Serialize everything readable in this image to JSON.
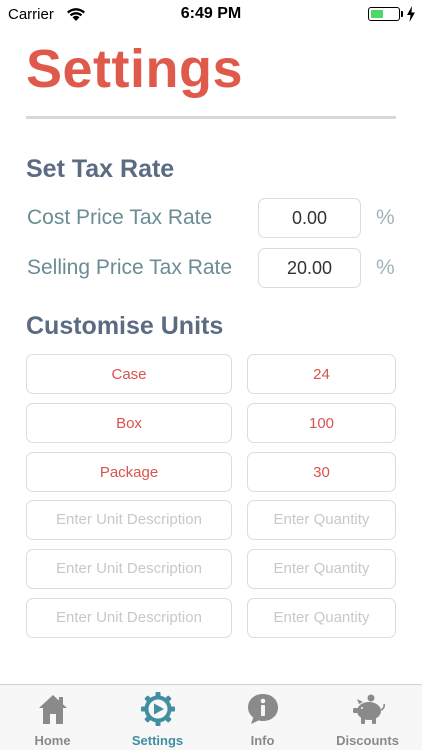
{
  "status_bar": {
    "carrier": "Carrier",
    "time": "6:49 PM",
    "battery_level": 0.45,
    "battery_color": "#4cd964"
  },
  "title": "Settings",
  "tax_section": {
    "heading": "Set Tax Rate",
    "rows": [
      {
        "label": "Cost Price Tax Rate",
        "value": "0.00",
        "unit": "%"
      },
      {
        "label": "Selling Price Tax Rate",
        "value": "20.00",
        "unit": "%"
      }
    ]
  },
  "units_section": {
    "heading": "Customise Units",
    "desc_placeholder": "Enter Unit Description",
    "qty_placeholder": "Enter Quantity",
    "rows": [
      {
        "description": "Case",
        "quantity": "24"
      },
      {
        "description": "Box",
        "quantity": "100"
      },
      {
        "description": "Package",
        "quantity": "30"
      },
      {
        "description": "",
        "quantity": ""
      },
      {
        "description": "",
        "quantity": ""
      },
      {
        "description": "",
        "quantity": ""
      }
    ]
  },
  "tab_bar": {
    "active_color": "#3f8fa0",
    "items": [
      {
        "label": "Home",
        "icon": "house-icon"
      },
      {
        "label": "Settings",
        "icon": "gear-icon",
        "active": true
      },
      {
        "label": "Info",
        "icon": "info-icon"
      },
      {
        "label": "Discounts",
        "icon": "piggy-bank-icon"
      }
    ]
  },
  "colors": {
    "title": "#e05a4c",
    "section_heading": "#5b6b82",
    "label": "#6a8c92",
    "unit_text": "#d9534f"
  }
}
